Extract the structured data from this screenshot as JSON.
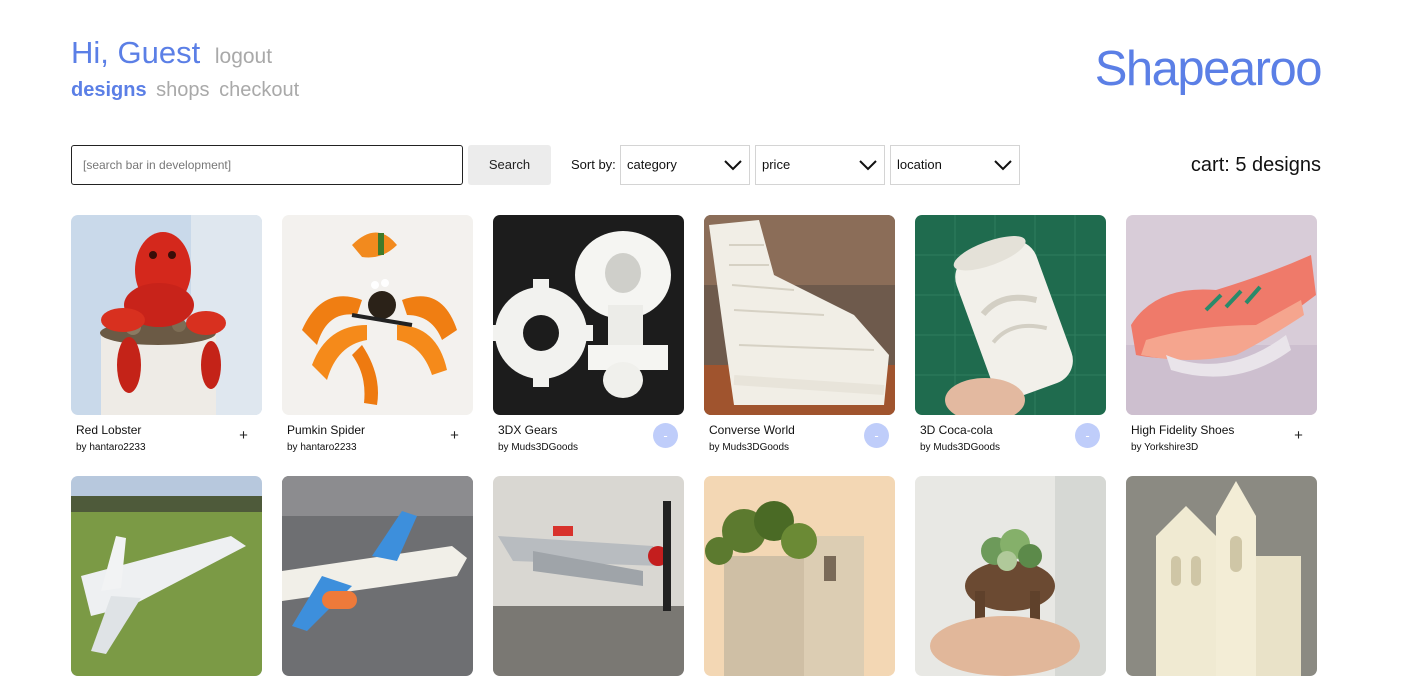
{
  "header": {
    "greeting": "Hi, Guest",
    "logout": "logout",
    "brand": "Shapearoo",
    "nav": [
      {
        "label": "designs",
        "active": true
      },
      {
        "label": "shops",
        "active": false
      },
      {
        "label": "checkout",
        "active": false
      }
    ]
  },
  "toolbar": {
    "search_placeholder": "[search bar in development]",
    "search_button": "Search",
    "sort_label": "Sort by:",
    "sort_options": [
      "category",
      "price",
      "location"
    ],
    "cart": "cart: 5 designs"
  },
  "colors": {
    "accent": "#5b7fe6",
    "muted": "#a9a9a9",
    "remove_button": "#bfcdfa"
  },
  "designs": [
    {
      "title": "Red Lobster",
      "author": "by hantaro2233",
      "action": "+",
      "image": "red-lobster-planter"
    },
    {
      "title": "Pumkin Spider",
      "author": "by hantaro2233",
      "action": "+",
      "image": "pumpkin-spider"
    },
    {
      "title": "3DX Gears",
      "author": "by Muds3DGoods",
      "action": "-",
      "image": "white-gears"
    },
    {
      "title": "Converse World",
      "author": "by Muds3DGoods",
      "action": "-",
      "image": "sneaker-city"
    },
    {
      "title": "3D Coca-cola",
      "author": "by Muds3DGoods",
      "action": "-",
      "image": "coca-cola-can"
    },
    {
      "title": "High Fidelity Shoes",
      "author": "by Yorkshire3D",
      "action": "+",
      "image": "lattice-shoe"
    },
    {
      "image": "glider-plane"
    },
    {
      "image": "airliner-model"
    },
    {
      "image": "propeller-plane"
    },
    {
      "image": "building-planter"
    },
    {
      "image": "elephant-planter"
    },
    {
      "image": "cathedral-model"
    }
  ]
}
